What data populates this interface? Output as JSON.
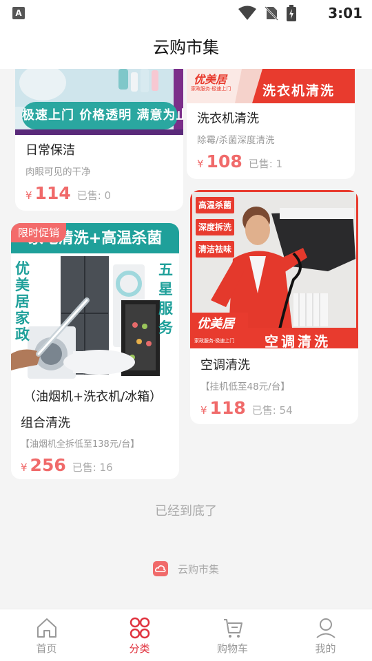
{
  "status_bar": {
    "time": "3:01",
    "indicator": "A"
  },
  "header": {
    "title": "云购市集"
  },
  "products": [
    {
      "id": "p1",
      "name": "日常保洁",
      "subtitle": "肉眼可见的干净",
      "currency": "¥",
      "price": "114",
      "sold": "已售: 0",
      "image_text": "极速上门 价格透明 满意为止"
    },
    {
      "id": "p2",
      "name": "洗衣机清洗",
      "subtitle": "除霉/杀菌深度清洗",
      "currency": "¥",
      "price": "108",
      "sold": "已售: 1",
      "image_brand": "优美居",
      "image_slogan": "家政服务·极速上门",
      "image_text": "洗衣机清洗"
    },
    {
      "id": "p3",
      "name_line1": "（油烟机+洗衣机/冰箱）",
      "name": "组合清洗",
      "subtitle": "【油烟机全拆低至138元/台】",
      "currency": "¥",
      "price": "256",
      "sold": "已售: 16",
      "badge": "限时促销",
      "image_banner": "家电清洗+高温杀菌",
      "image_left": "优美居家政",
      "image_right": "五星服务"
    },
    {
      "id": "p4",
      "name": "空调清洗",
      "subtitle": "【挂机低至48元/台】",
      "currency": "¥",
      "price": "118",
      "sold": "已售: 54",
      "image_tags": [
        "高温杀菌",
        "深度拆洗",
        "清洁祛味"
      ],
      "image_brand": "优美居",
      "image_slogan": "家政服务·极速上门",
      "image_text": "空调清洗"
    }
  ],
  "end_text": "已经到底了",
  "footer": {
    "brand": "云购市集"
  },
  "nav": [
    {
      "label": "首页",
      "icon": "home-icon",
      "active": false
    },
    {
      "label": "分类",
      "icon": "category-icon",
      "active": true
    },
    {
      "label": "购物车",
      "icon": "cart-icon",
      "active": false
    },
    {
      "label": "我的",
      "icon": "user-icon",
      "active": false
    }
  ],
  "colors": {
    "price": "#f06a6a",
    "accent": "#e0333f",
    "badge": "#f36b6b",
    "teal": "#1fa09a"
  }
}
